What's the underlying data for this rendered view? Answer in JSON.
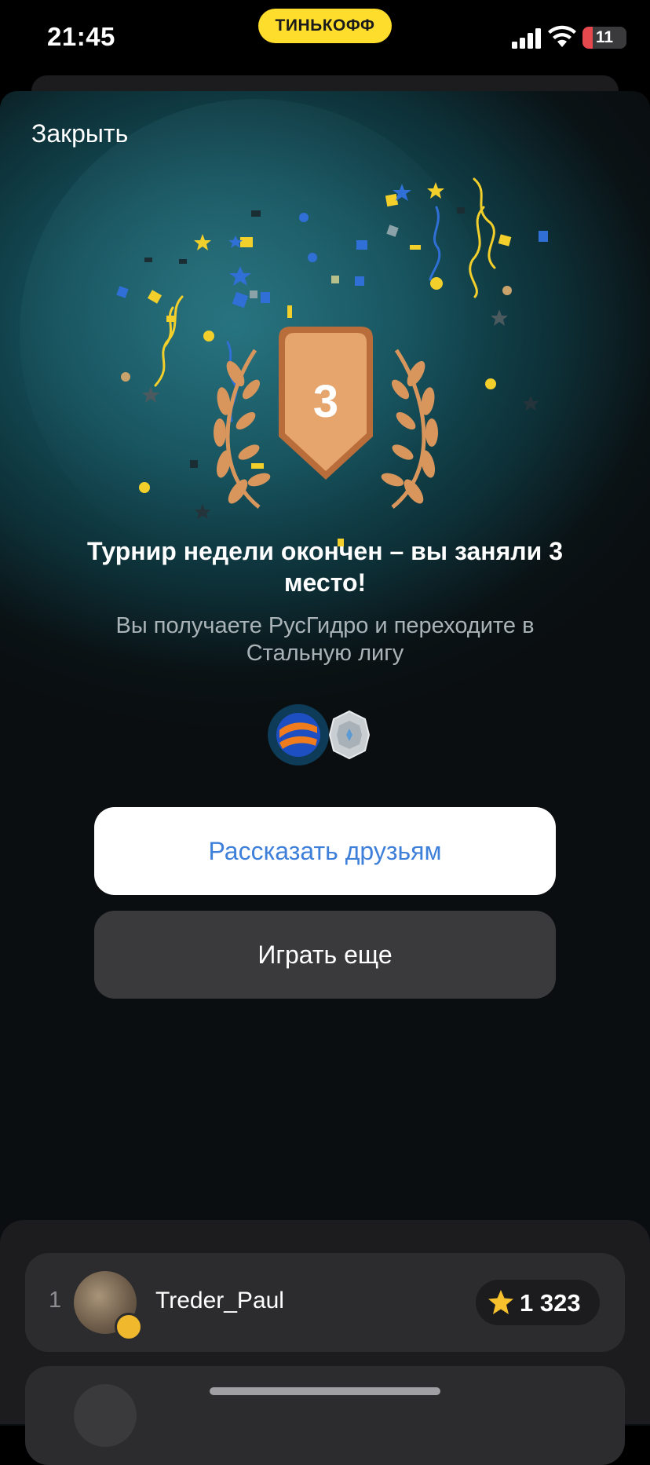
{
  "status_bar": {
    "time": "21:45",
    "carrier_pill": "ТИНЬКОФФ",
    "battery_level": "11",
    "battery_fraction": 0.11
  },
  "modal": {
    "close_label": "Закрыть",
    "place_number": "3",
    "title": "Турнир недели окончен – вы заняли 3 место!",
    "subtitle": "Вы получаете РусГидро и переходите в Стальную лигу",
    "reward_icons": [
      "rushydro-logo-icon",
      "steel-league-badge-icon"
    ],
    "buttons": {
      "share": "Рассказать друзьям",
      "play_again": "Играть еще"
    }
  },
  "leaderboard": {
    "rows": [
      {
        "rank": "1",
        "username": "Treder_Paul",
        "score": "1 323"
      },
      {
        "rank": "",
        "username": "",
        "score": ""
      }
    ]
  },
  "colors": {
    "brand_yellow": "#ffdd2d",
    "share_text": "#3d7fd9",
    "bronze": "#d9965c",
    "battery_red": "#e5484d"
  }
}
